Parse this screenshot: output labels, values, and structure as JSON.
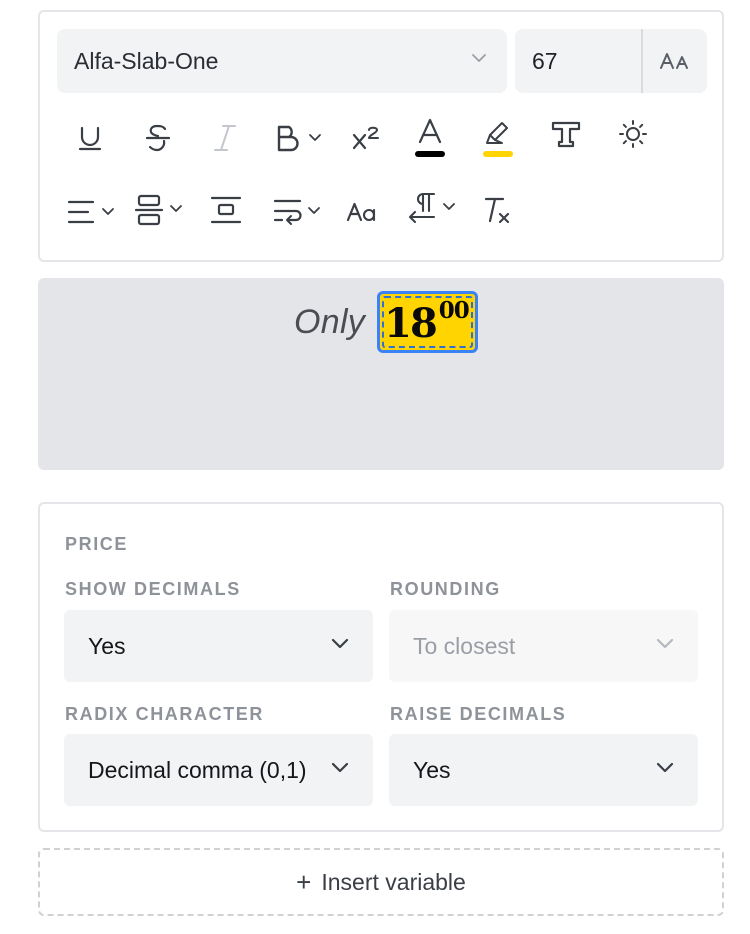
{
  "toolbar": {
    "font_family": "Alfa-Slab-One",
    "font_size": "67",
    "text_color": "#000000",
    "highlight_color": "#ffd400",
    "icons_row1": [
      "underline-icon",
      "strikethrough-icon",
      "italic-icon",
      "bold-icon",
      "superscript-icon",
      "text-color-icon",
      "highlight-icon",
      "text-style-icon",
      "brightness-icon"
    ],
    "icons_row2": [
      "align-icon",
      "vertical-align-icon",
      "spacing-icon",
      "text-wrap-icon",
      "text-case-icon",
      "text-direction-icon",
      "clear-format-icon"
    ]
  },
  "preview": {
    "prefix": "Only",
    "price_integer": "18",
    "price_decimals": "00"
  },
  "price_settings": {
    "section_title": "PRICE",
    "show_decimals_label": "SHOW DECIMALS",
    "show_decimals_value": "Yes",
    "rounding_label": "ROUNDING",
    "rounding_value": "To closest",
    "radix_label": "RADIX CHARACTER",
    "radix_value": "Decimal comma (0,1)",
    "raise_decimals_label": "RAISE DECIMALS",
    "raise_decimals_value": "Yes"
  },
  "actions": {
    "insert_variable_label": "Insert variable"
  }
}
